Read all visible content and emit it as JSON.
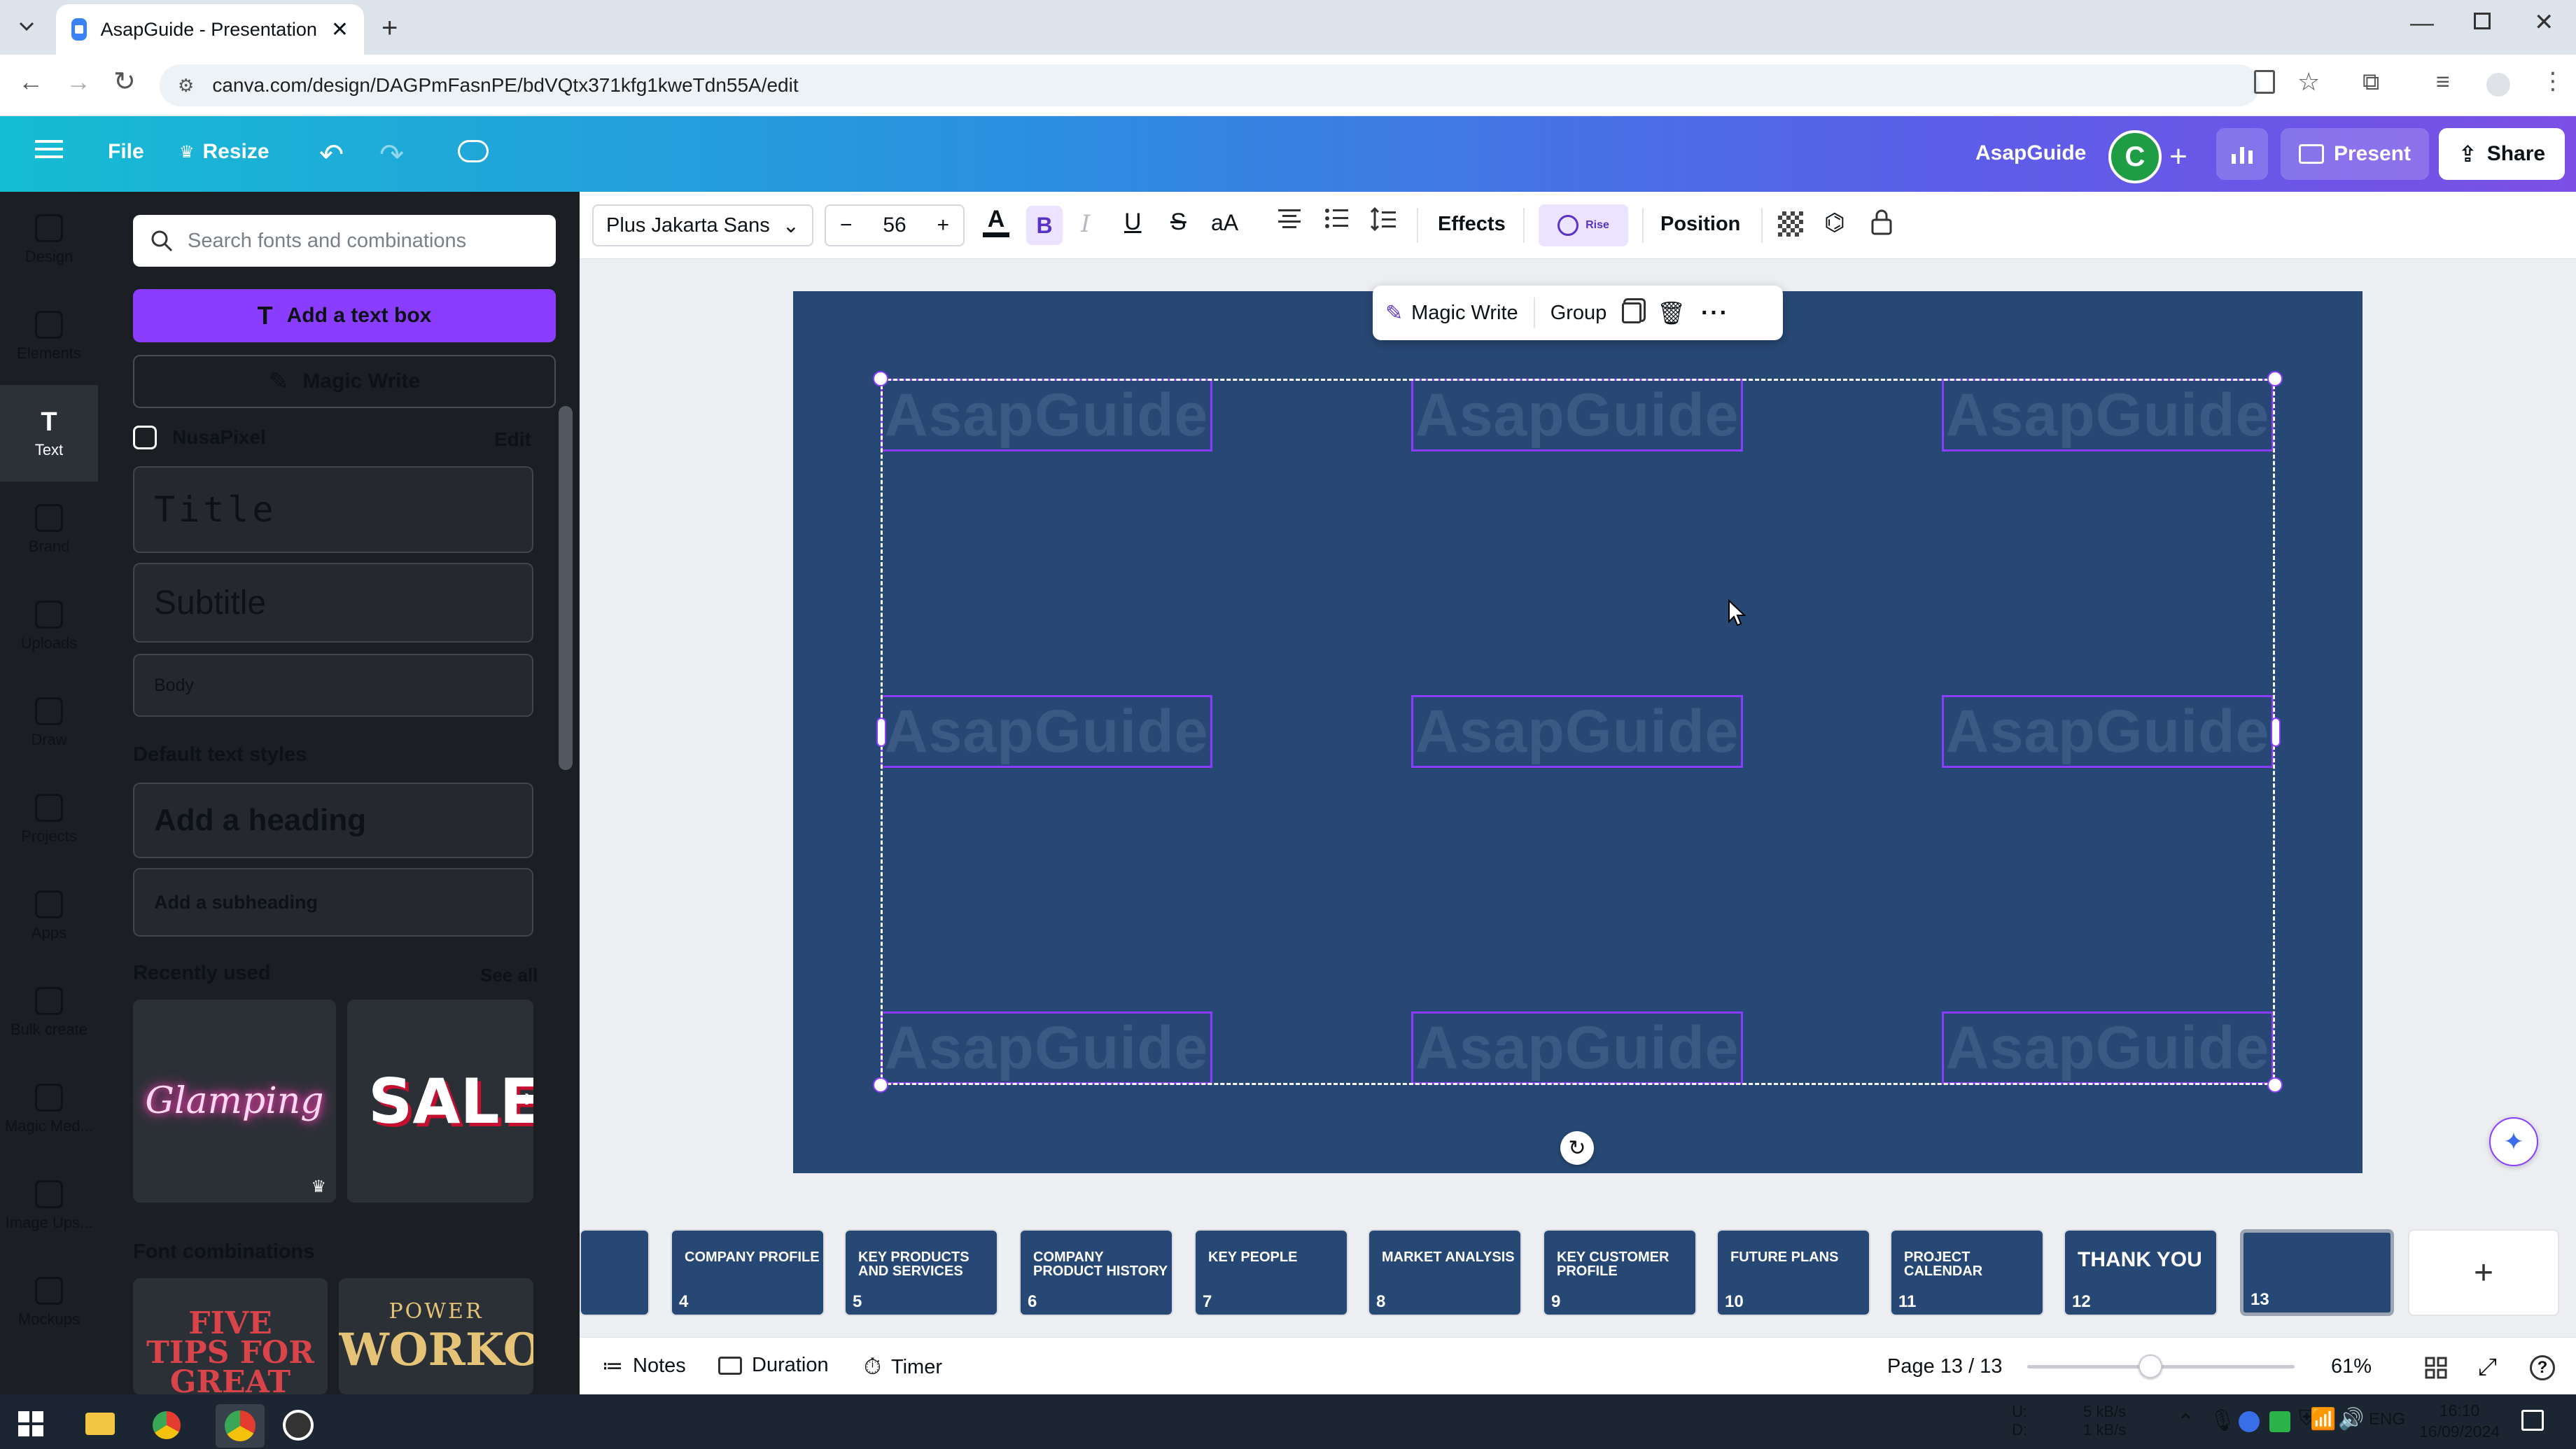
{
  "browser": {
    "tab_title": "AsapGuide - Presentation",
    "url": "canva.com/design/DAGPmFasnPE/bdVQtx371kfg1kweTdn55A/edit"
  },
  "header": {
    "file": "File",
    "resize": "Resize",
    "doc_name": "AsapGuide",
    "avatar_letter": "C",
    "present": "Present",
    "share": "Share"
  },
  "rail": {
    "items": [
      {
        "label": "Design",
        "icon": "design-icon"
      },
      {
        "label": "Elements",
        "icon": "elements-icon"
      },
      {
        "label": "Text",
        "icon": "text-icon"
      },
      {
        "label": "Brand",
        "icon": "brand-icon"
      },
      {
        "label": "Uploads",
        "icon": "upload-icon"
      },
      {
        "label": "Draw",
        "icon": "draw-icon"
      },
      {
        "label": "Projects",
        "icon": "folder-icon"
      },
      {
        "label": "Apps",
        "icon": "apps-icon"
      },
      {
        "label": "Bulk create",
        "icon": "bulk-icon"
      },
      {
        "label": "Magic Med...",
        "icon": "magic-media-icon"
      },
      {
        "label": "Image Ups...",
        "icon": "image-upscale-icon"
      },
      {
        "label": "Mockups",
        "icon": "mockups-icon"
      }
    ]
  },
  "panel": {
    "search_placeholder": "Search fonts and combinations",
    "add_text_box": "Add a text box",
    "magic_write": "Magic Write",
    "brand_kit": "NusaPixel",
    "edit": "Edit",
    "title": "Title",
    "subtitle": "Subtitle",
    "body": "Body",
    "default_styles": "Default text styles",
    "add_heading": "Add a heading",
    "add_subheading": "Add a subheading",
    "recently_used": "Recently used",
    "see_all": "See all",
    "recent_1": "Glamping",
    "recent_2": "SALE",
    "font_combinations": "Font combinations",
    "combo_1": "FIVE TIPS FOR GREAT",
    "combo_2a": "POWER",
    "combo_2b": "WORKOUT"
  },
  "toolbar": {
    "font": "Plus Jakarta Sans",
    "size": "56",
    "effects": "Effects",
    "rise": "Rise",
    "position": "Position",
    "text_color": "#0d1216"
  },
  "float_toolbar": {
    "magic_write": "Magic Write",
    "group": "Group"
  },
  "slide": {
    "background": "#274874",
    "box_text": "AsapGuide"
  },
  "pages": [
    {
      "num": "4",
      "label": "COMPANY PROFILE"
    },
    {
      "num": "5",
      "label": "KEY PRODUCTS AND SERVICES"
    },
    {
      "num": "6",
      "label": "COMPANY PRODUCT HISTORY"
    },
    {
      "num": "7",
      "label": "KEY PEOPLE"
    },
    {
      "num": "8",
      "label": "MARKET ANALYSIS"
    },
    {
      "num": "9",
      "label": "KEY CUSTOMER PROFILE"
    },
    {
      "num": "10",
      "label": "FUTURE PLANS"
    },
    {
      "num": "11",
      "label": "PROJECT CALENDAR"
    },
    {
      "num": "12",
      "label": "THANK YOU"
    },
    {
      "num": "13",
      "label": ""
    }
  ],
  "footer": {
    "notes": "Notes",
    "duration": "Duration",
    "timer": "Timer",
    "page_indicator": "Page 13 / 13",
    "zoom": "61%",
    "zoom_level": 0.46
  },
  "taskbar": {
    "net_up": "5 kB/s",
    "net_down": "1 kB/s",
    "up_label": "U:",
    "down_label": "D:",
    "lang": "ENG",
    "time": "16:10",
    "date": "16/09/2024"
  }
}
